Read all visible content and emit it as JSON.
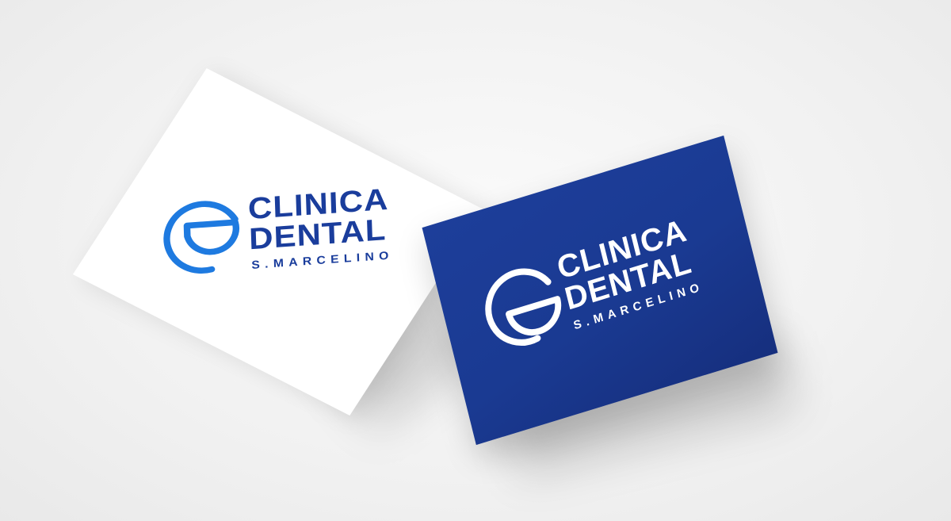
{
  "brand": {
    "line1": "CLINICA",
    "line2": "DENTAL",
    "line3": "S.MARCELINO"
  },
  "colors": {
    "background": "#f1f1f1",
    "white_card": "#ffffff",
    "blue_card": "#1a3a92",
    "logo_light_blue": "#1e7ae0",
    "logo_navy": "#1a3d9c",
    "logo_on_blue": "#ffffff"
  },
  "icons": {
    "logo_mark": "cd-monogram-icon"
  }
}
